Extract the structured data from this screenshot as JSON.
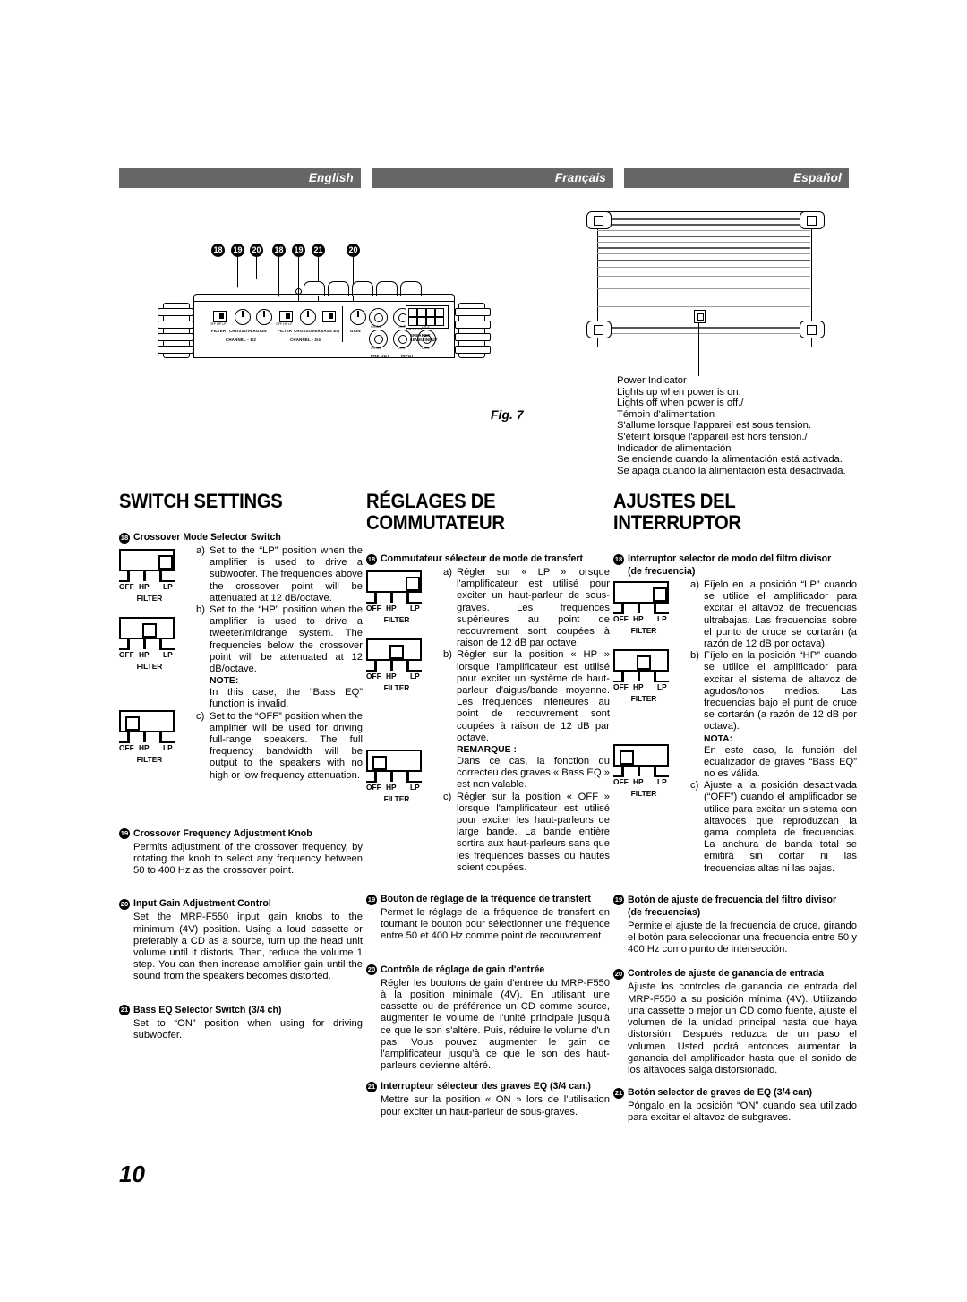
{
  "language_tabs": [
    {
      "id": "english",
      "label": "English"
    },
    {
      "id": "francais",
      "label": "Français"
    },
    {
      "id": "espanol",
      "label": "Español"
    }
  ],
  "figure": {
    "label": "Fig. 7",
    "callouts": [
      "18",
      "19",
      "20",
      "18",
      "19",
      "21",
      "20"
    ],
    "rear_panel_labels": {
      "filter_1": "FILTER",
      "crossover_1": "CROSSOVER",
      "gain_1": "GAIN",
      "channel_12": "CHANNEL - 1/2",
      "filter_2": "FILTER",
      "crossover_2": "CROSSOVER",
      "bass_eq": "BASS EQ",
      "channel_34": "CHANNEL - 3/4",
      "gain_2": "GAIN",
      "pre_out": "PRE OUT",
      "input": "INPUT",
      "speaker_level_input": "SPEAKER\nLEVEL INPUT",
      "jack_ch34_top": "CH-3/4",
      "jack_ch1": "CH-1",
      "jack_ch3": "CH-3",
      "jack_ch34_bot": "CH-3/4",
      "jack_ch2": "CH-2",
      "jack_ch4": "CH-4",
      "switch_positions": "OFF HP LP",
      "bass_eq_positions": "OFF ON",
      "term_numbers": "CH-1   2   3   4"
    },
    "power_indicator_note": "Power Indicator\nLights up when power is on.\nLights off when power is off./\nTémoin d'alimentation\nS'allume lorsque l'appareil est sous tension.\nS'éteint lorsque l'appareil est hors tension./\nIndicador de alimentación\nSe enciende cuando la alimentación está activada.\nSe apaga cuando la alimentación está desactivada."
  },
  "switch_figure_labels": {
    "off": "OFF",
    "hp": "HP",
    "lp": "LP",
    "filter": "FILTER"
  },
  "columns": {
    "english": {
      "title": "SWITCH SETTINGS",
      "items": [
        {
          "num": "18",
          "heading": "Crossover Mode Selector Switch",
          "subheading": "",
          "bullets": [
            {
              "mark": "a)",
              "text": "Set to the “LP” position when the amplifier is used to drive a subwoofer. The frequencies above the crossover point will be attenuated at 12 dB/octave."
            },
            {
              "mark": "b)",
              "text": "Set to the “HP” position when the amplifier is used to drive a tweeter/midrange system. The frequencies below the crossover point will be attenuated at 12 dB/octave."
            }
          ],
          "note_label": "NOTE:",
          "note_text": "In this case, the “Bass EQ” function is invalid.",
          "bullets_after_note": [
            {
              "mark": "c)",
              "text": "Set to the “OFF” position when the amplifier will be used for driving full-range speakers. The full frequency bandwidth will be output to the speakers with no high or low frequency attenuation."
            }
          ]
        },
        {
          "num": "19",
          "heading": "Crossover Frequency Adjustment Knob",
          "subheading": "",
          "body": "Permits adjustment of the crossover frequency, by rotating the knob to select any frequency between 50 to 400 Hz as the crossover point."
        },
        {
          "num": "20",
          "heading": "Input Gain Adjustment Control",
          "subheading": "",
          "body": "Set the MRP-F550 input gain knobs to the minimum (4V) position. Using a loud cassette or preferably a CD as a source, turn up the head unit volume until it distorts. Then, reduce the volume 1 step. You can then increase amplifier gain until the sound from the speakers becomes distorted."
        },
        {
          "num": "21",
          "heading": "Bass EQ Selector Switch (3/4 ch)",
          "subheading": "",
          "body": "Set to “ON” position when using for driving subwoofer."
        }
      ]
    },
    "francais": {
      "title": "RÉGLAGES DE COMMUTATEUR",
      "items": [
        {
          "num": "18",
          "heading": "Commutateur sélecteur de mode de transfert",
          "subheading": "",
          "bullets": [
            {
              "mark": "a)",
              "text": "Régler sur « LP » lorsque l'amplificateur est utilisé pour exciter un haut-parleur de sous-graves. Les fréquences supérieures au point de recouvrement sont coupées à raison de 12 dB par octave."
            },
            {
              "mark": "b)",
              "text": "Régler sur la position « HP » lorsque l'amplificateur est utilisé pour exciter un système de haut-parleur d'aigus/bande moyenne. Les fréquences inférieures au point de recouvrement sont coupées à raison de 12 dB par octave."
            }
          ],
          "note_label": "REMARQUE :",
          "note_text": "Dans ce cas, la fonction du correcteu des graves « Bass EQ » est non valable.",
          "bullets_after_note": [
            {
              "mark": "c)",
              "text": "Régler sur la position « OFF » lorsque l'amplificateur est utilisé pour exciter les haut-parleurs de large bande. La bande entière sortira aux haut-parleurs sans que les fréquences basses ou hautes soient coupées."
            }
          ]
        },
        {
          "num": "19",
          "heading": "Bouton de réglage de la fréquence de transfert",
          "subheading": "",
          "body": "Permet le réglage de la fréquence de transfert en tournant le bouton pour sélectionner une fréquence entre 50 et 400 Hz comme point de recouvrement."
        },
        {
          "num": "20",
          "heading": "Contrôle de réglage de gain d'entrée",
          "subheading": "",
          "body": "Régler les boutons de gain d'entrée du MRP-F550 à la position minimale (4V). En utilisant une cassette ou de préférence un CD comme source, augmenter le volume de l'unité principale jusqu'à ce que le son s'altère. Puis, réduire le volume d'un pas. Vous pouvez augmenter le gain de l'amplificateur jusqu'à ce que le son des haut-parleurs devienne altéré."
        },
        {
          "num": "21",
          "heading": "Interrupteur sélecteur des graves EQ (3/4 can.)",
          "subheading": "",
          "body": "Mettre sur la position « ON » lors de l'utilisation pour exciter un haut-parleur de sous-graves."
        }
      ]
    },
    "espanol": {
      "title": "AJUSTES DEL INTERRUPTOR",
      "items": [
        {
          "num": "18",
          "heading": "Interruptor selector de modo del filtro divisor",
          "subheading": "(de frecuencia)",
          "bullets": [
            {
              "mark": "a)",
              "text": "Fíjelo en la posición “LP” cuando se utilice el amplificador para excitar el altavoz de frecuencias ultrabajas. Las frecuencias sobre el punto de cruce se cortarán (a razón de 12 dB por octava)."
            },
            {
              "mark": "b)",
              "text": "Fíjelo en la posición “HP” cuando se utilice el amplificador para excitar el sistema de altavoz de agudos/tonos medios. Las frecuencias bajo el punt de cruce se cortarán (a razón de 12 dB por octava)."
            }
          ],
          "note_label": "NOTA:",
          "note_text": "En este caso, la función del ecualizador de graves “Bass EQ” no es válida.",
          "bullets_after_note": [
            {
              "mark": "c)",
              "text": "Ajuste a la posición desactivada (“OFF”) cuando el amplificador se utilice para excitar un sistema con altavoces que reproduzcan la gama completa de frecuencias. La anchura de banda total se emitirá sin cortar ni las frecuencias altas ni las bajas."
            }
          ]
        },
        {
          "num": "19",
          "heading": "Botón de ajuste de frecuencia del filtro divisor",
          "subheading": "(de frecuencias)",
          "body": "Permite el ajuste de la frecuencia de cruce, girando el botón para seleccionar una frecuencia entre 50 y 400 Hz como punto de intersección."
        },
        {
          "num": "20",
          "heading": "Controles de ajuste de ganancia de entrada",
          "subheading": "",
          "body": "Ajuste los controles de ganancia de entrada del MRP-F550 a su posición mínima (4V). Utilizando una cassette o mejor un CD como fuente, ajuste el volumen de la unidad principal hasta que haya distorsión. Después reduzca de un paso el volumen. Usted podrá entonces aumentar la ganancia del amplificador hasta que el sonido de los altavoces salga distorsionado."
        },
        {
          "num": "21",
          "heading": "Botón selector de graves de EQ (3/4 can)",
          "subheading": "",
          "body": "Póngalo en la posición “ON” cuando sea utilizado para excitar el altavoz de subgraves."
        }
      ]
    }
  },
  "page_number": "10",
  "colors": {
    "tab_background": "#666666",
    "tab_text": "#ffffff",
    "ink": "#000000",
    "paper": "#ffffff"
  }
}
